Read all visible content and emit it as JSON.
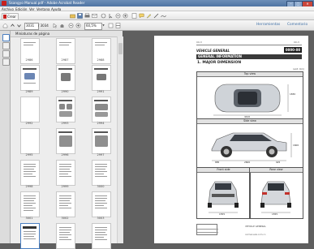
{
  "window": {
    "title": "Ssangyo Manual.pdf - Adobe Acrobat Reader",
    "min_glyph": "–",
    "max_glyph": "□",
    "close_glyph": "✕"
  },
  "menu": [
    "Archivo",
    "Edición",
    "Ver",
    "Ventana",
    "Ayuda"
  ],
  "toolbar": {
    "create_label": "Crear",
    "page_current": "3031",
    "page_total": "/ 3034",
    "zoom": "60,5%",
    "tools_label": "Herramientas",
    "comment_label": "Comentario"
  },
  "sidebar": {
    "title": "Miniaturas de página",
    "pages": [
      "2986",
      "2987",
      "2988",
      "2989",
      "2990",
      "2991",
      "2992",
      "2993",
      "2994",
      "2995",
      "2996",
      "2997",
      "2998",
      "2999",
      "3000",
      "3001",
      "3002",
      "3003",
      "3004",
      "3005",
      "3006"
    ]
  },
  "document": {
    "header_left": "00-3",
    "header_right": "0000-00",
    "header_code": "00-3",
    "section_badge": "VEHICLE GENERAL",
    "section_code": "0000-00",
    "section_title": "GENERAL INFORMATION",
    "subsection_title": "1. MAJOR DIMENSION",
    "unit": "(unit: mm)",
    "top_view": "Top view",
    "side_view": "Side view",
    "front_view": "Front side",
    "rear_view": "Rear view",
    "dims": {
      "length": "4410",
      "width": "1830",
      "height": "1600",
      "wheelbase": "2600",
      "front_overhang": "885",
      "rear_overhang": "925",
      "tread_front": "1555",
      "tread_rear": "1555"
    },
    "footer_center": "VEHICLE GENERAL",
    "footer_site": "carmanuals.com.cn"
  }
}
